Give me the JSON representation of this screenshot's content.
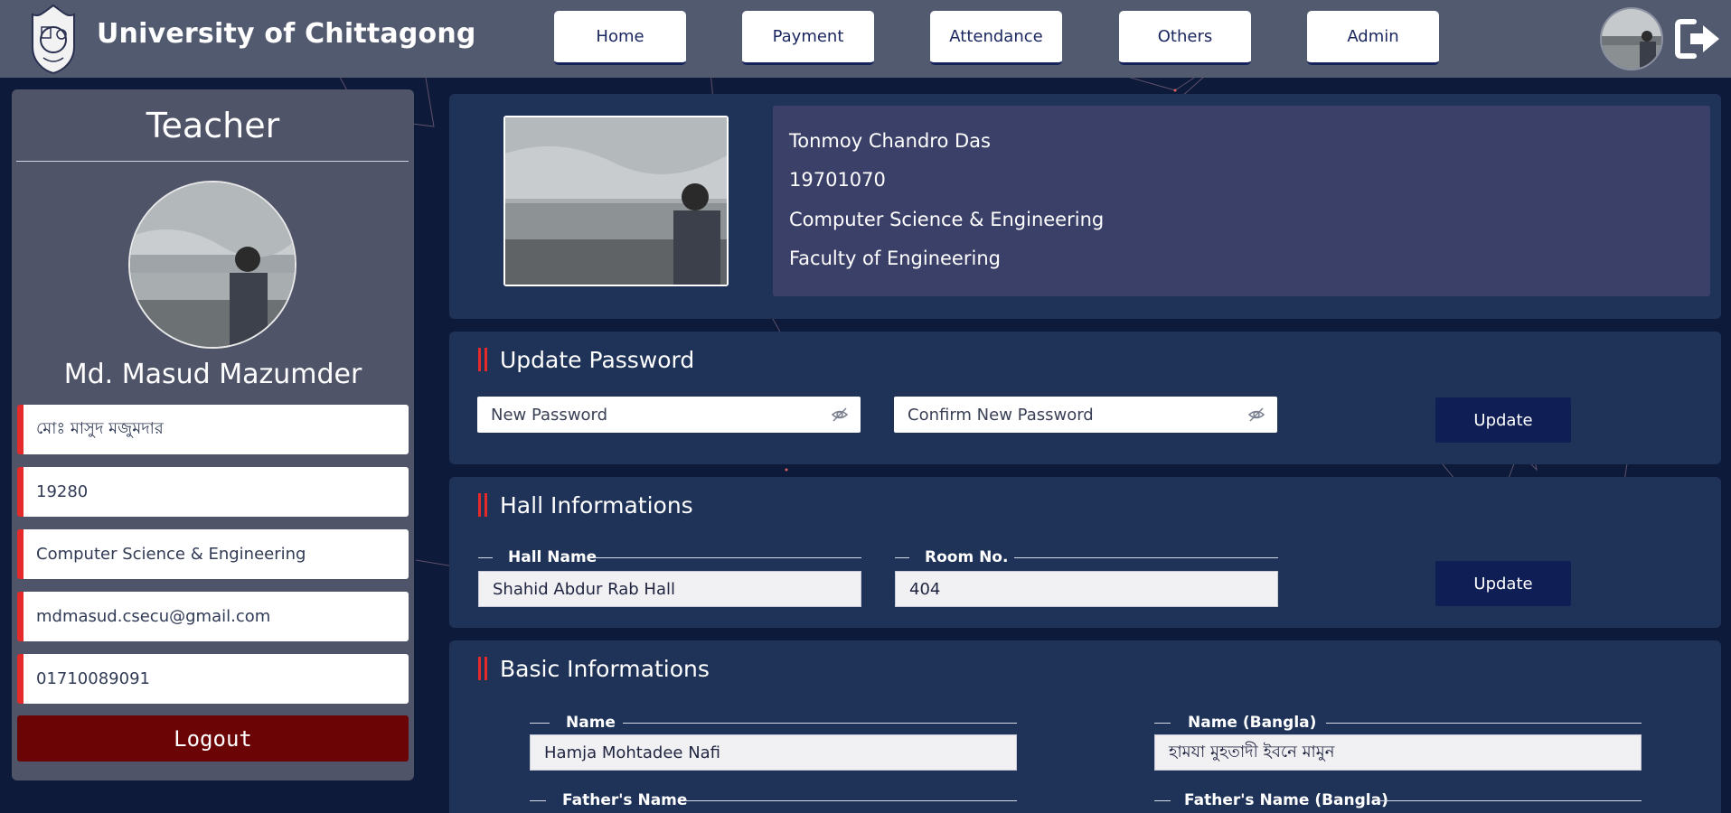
{
  "brand": {
    "name": "University of Chittagong"
  },
  "nav": {
    "items": [
      {
        "label": "Home"
      },
      {
        "label": "Payment"
      },
      {
        "label": "Attendance"
      },
      {
        "label": "Others"
      },
      {
        "label": "Admin"
      }
    ]
  },
  "sidebar": {
    "role": "Teacher",
    "name": "Md. Masud Mazumder",
    "fields": {
      "name_bangla": "মোঃ মাসুদ মজুমদার",
      "id": "19280",
      "department": "Computer Science & Engineering",
      "email": "mdmasud.csecu@gmail.com",
      "phone": "01710089091"
    },
    "logout_label": "Logout"
  },
  "profile": {
    "name": "Tonmoy Chandro Das",
    "id": "19701070",
    "department": "Computer Science & Engineering",
    "faculty": "Faculty of Engineering"
  },
  "update_password": {
    "title": "Update Password",
    "new_placeholder": "New Password",
    "confirm_placeholder": "Confirm New Password",
    "button": "Update"
  },
  "hall": {
    "title": "Hall Informations",
    "hall_label": "Hall Name",
    "hall_value": "Shahid Abdur Rab Hall",
    "room_label": "Room No.",
    "room_value": "404",
    "button": "Update"
  },
  "basic": {
    "title": "Basic Informations",
    "name_label": "Name",
    "name_value": "Hamja Mohtadee Nafi",
    "name_bangla_label": "Name (Bangla)",
    "name_bangla_value": "হামযা মুহতাদী ইবনে মামুন",
    "father_label": "Father's Name",
    "father_bangla_label": "Father's Name (Bangla)"
  },
  "colors": {
    "nav_bg": "#525a70",
    "page_bg": "#0e1a3a",
    "panel_bg": "#1f3358",
    "accent_red": "#e62a2a",
    "button_navy": "#0f1f55",
    "logout_bg": "#6b0505"
  },
  "icons": {
    "logo": "university-seal-icon",
    "logout": "sign-out-icon",
    "password_toggle": "eye-slash-icon"
  }
}
